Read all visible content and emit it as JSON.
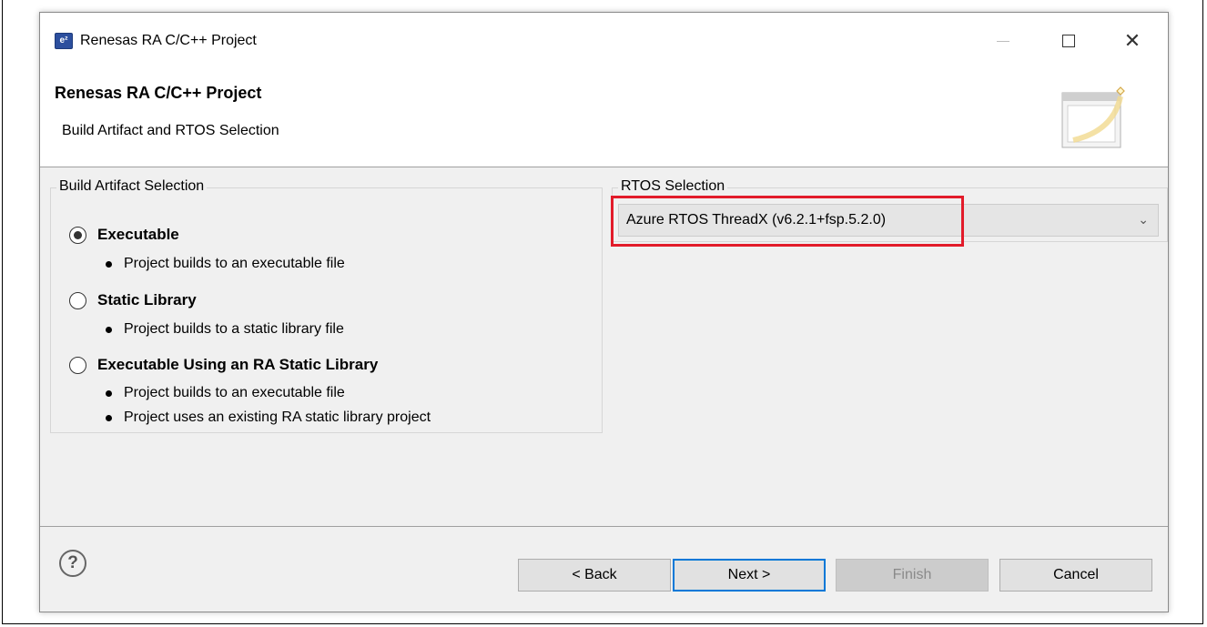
{
  "window": {
    "title": "Renesas RA C/C++ Project",
    "icon": "renesas-app-icon",
    "controls": {
      "minimize": "minimize-icon",
      "maximize": "maximize-icon",
      "close": "close-icon",
      "close_glyph": "✕"
    }
  },
  "header": {
    "title": "Renesas RA C/C++ Project",
    "subtitle": "Build Artifact and RTOS Selection"
  },
  "build_artifact": {
    "legend": "Build Artifact Selection",
    "options": [
      {
        "label": "Executable",
        "selected": true,
        "bullets": [
          "Project builds to an executable file"
        ]
      },
      {
        "label": "Static Library",
        "selected": false,
        "bullets": [
          "Project builds to a static library file"
        ]
      },
      {
        "label": "Executable Using an RA Static Library",
        "selected": false,
        "bullets": [
          "Project builds to an executable file",
          "Project uses an existing RA static library project"
        ]
      }
    ]
  },
  "rtos": {
    "legend": "RTOS Selection",
    "selected": "Azure RTOS ThreadX (v6.2.1+fsp.5.2.0)",
    "chevron": "⌄",
    "highlight_color": "#e21b2a"
  },
  "footer": {
    "help_glyph": "?",
    "back": "< Back",
    "next": "Next >",
    "finish": "Finish",
    "cancel": "Cancel"
  },
  "colors": {
    "background": "#f0f0f0",
    "focus_border": "#0078d7",
    "highlight": "#e21b2a"
  }
}
